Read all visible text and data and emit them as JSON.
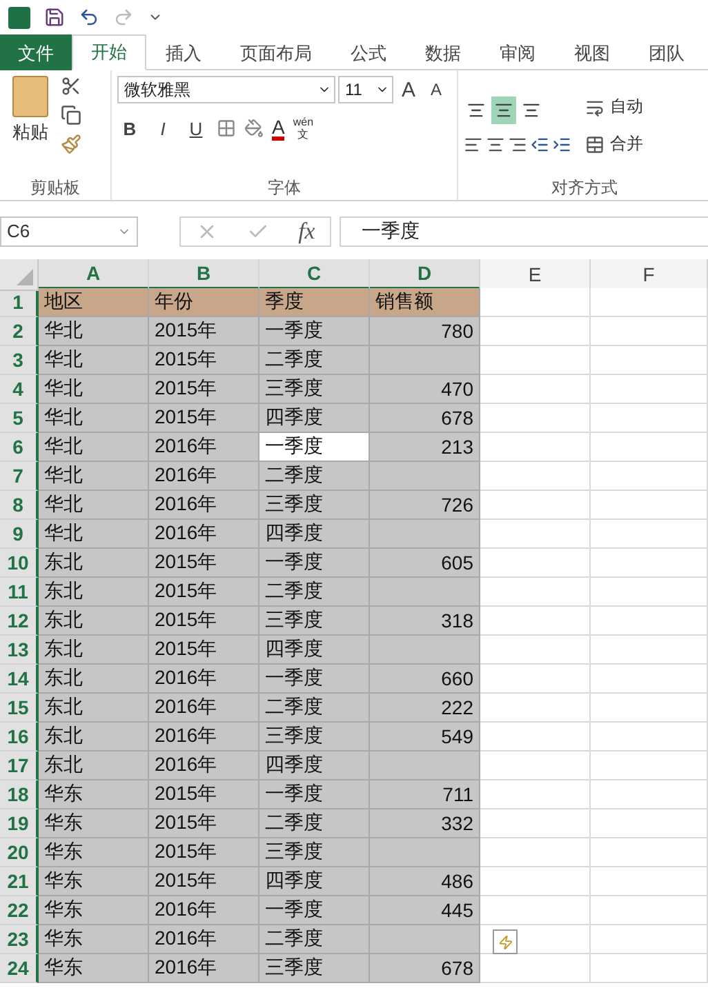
{
  "tabs": [
    {
      "label": "文件",
      "kind": "file",
      "selected": false
    },
    {
      "label": "开始",
      "kind": "tab",
      "selected": true
    },
    {
      "label": "插入",
      "kind": "tab",
      "selected": false
    },
    {
      "label": "页面布局",
      "kind": "tab",
      "selected": false
    },
    {
      "label": "公式",
      "kind": "tab",
      "selected": false
    },
    {
      "label": "数据",
      "kind": "tab",
      "selected": false
    },
    {
      "label": "审阅",
      "kind": "tab",
      "selected": false
    },
    {
      "label": "视图",
      "kind": "tab",
      "selected": false
    },
    {
      "label": "团队",
      "kind": "tab",
      "selected": false
    }
  ],
  "ribbon": {
    "clipboard": {
      "paste_label": "粘贴",
      "title": "剪贴板"
    },
    "font": {
      "font_name": "微软雅黑",
      "font_size": "11",
      "grow": "A",
      "shrink": "A",
      "bold": "B",
      "italic": "I",
      "underline": "U",
      "font_color": "A",
      "phonetic_top": "wén",
      "phonetic_bottom": "文",
      "title": "字体"
    },
    "alignment": {
      "middle_align_selected": true,
      "wrap_text": "自动",
      "merge": "合并",
      "title": "对齐方式"
    }
  },
  "formula_bar": {
    "name_box": "C6",
    "fx": "fx",
    "value": "一季度"
  },
  "sheet": {
    "columns": [
      {
        "label": "A",
        "selected": true
      },
      {
        "label": "B",
        "selected": true
      },
      {
        "label": "C",
        "selected": true
      },
      {
        "label": "D",
        "selected": true
      },
      {
        "label": "E",
        "selected": false
      },
      {
        "label": "F",
        "selected": false
      }
    ],
    "rows": [
      {
        "number": "1",
        "kind": "header",
        "cells": [
          "地区",
          "年份",
          "季度",
          "销售额"
        ],
        "active": [
          false,
          false,
          false,
          false
        ]
      },
      {
        "number": "2",
        "kind": "data",
        "cells": [
          "华北",
          "2015年",
          "一季度",
          "780"
        ],
        "active": [
          false,
          false,
          false,
          false
        ]
      },
      {
        "number": "3",
        "kind": "data",
        "cells": [
          "华北",
          "2015年",
          "二季度",
          null
        ],
        "active": [
          false,
          false,
          false,
          false
        ]
      },
      {
        "number": "4",
        "kind": "data",
        "cells": [
          "华北",
          "2015年",
          "三季度",
          "470"
        ],
        "active": [
          false,
          false,
          false,
          false
        ]
      },
      {
        "number": "5",
        "kind": "data",
        "cells": [
          "华北",
          "2015年",
          "四季度",
          "678"
        ],
        "active": [
          false,
          false,
          false,
          false
        ]
      },
      {
        "number": "6",
        "kind": "data",
        "cells": [
          "华北",
          "2016年",
          "一季度",
          "213"
        ],
        "active": [
          false,
          false,
          true,
          false
        ]
      },
      {
        "number": "7",
        "kind": "data",
        "cells": [
          "华北",
          "2016年",
          "二季度",
          null
        ],
        "active": [
          false,
          false,
          false,
          false
        ]
      },
      {
        "number": "8",
        "kind": "data",
        "cells": [
          "华北",
          "2016年",
          "三季度",
          "726"
        ],
        "active": [
          false,
          false,
          false,
          false
        ]
      },
      {
        "number": "9",
        "kind": "data",
        "cells": [
          "华北",
          "2016年",
          "四季度",
          null
        ],
        "active": [
          false,
          false,
          false,
          false
        ]
      },
      {
        "number": "10",
        "kind": "data",
        "cells": [
          "东北",
          "2015年",
          "一季度",
          "605"
        ],
        "active": [
          false,
          false,
          false,
          false
        ]
      },
      {
        "number": "11",
        "kind": "data",
        "cells": [
          "东北",
          "2015年",
          "二季度",
          null
        ],
        "active": [
          false,
          false,
          false,
          false
        ]
      },
      {
        "number": "12",
        "kind": "data",
        "cells": [
          "东北",
          "2015年",
          "三季度",
          "318"
        ],
        "active": [
          false,
          false,
          false,
          false
        ]
      },
      {
        "number": "13",
        "kind": "data",
        "cells": [
          "东北",
          "2015年",
          "四季度",
          null
        ],
        "active": [
          false,
          false,
          false,
          false
        ]
      },
      {
        "number": "14",
        "kind": "data",
        "cells": [
          "东北",
          "2016年",
          "一季度",
          "660"
        ],
        "active": [
          false,
          false,
          false,
          false
        ]
      },
      {
        "number": "15",
        "kind": "data",
        "cells": [
          "东北",
          "2016年",
          "二季度",
          "222"
        ],
        "active": [
          false,
          false,
          false,
          false
        ]
      },
      {
        "number": "16",
        "kind": "data",
        "cells": [
          "东北",
          "2016年",
          "三季度",
          "549"
        ],
        "active": [
          false,
          false,
          false,
          false
        ]
      },
      {
        "number": "17",
        "kind": "data",
        "cells": [
          "东北",
          "2016年",
          "四季度",
          null
        ],
        "active": [
          false,
          false,
          false,
          false
        ]
      },
      {
        "number": "18",
        "kind": "data",
        "cells": [
          "华东",
          "2015年",
          "一季度",
          "711"
        ],
        "active": [
          false,
          false,
          false,
          false
        ]
      },
      {
        "number": "19",
        "kind": "data",
        "cells": [
          "华东",
          "2015年",
          "二季度",
          "332"
        ],
        "active": [
          false,
          false,
          false,
          false
        ]
      },
      {
        "number": "20",
        "kind": "data",
        "cells": [
          "华东",
          "2015年",
          "三季度",
          null
        ],
        "active": [
          false,
          false,
          false,
          false
        ]
      },
      {
        "number": "21",
        "kind": "data",
        "cells": [
          "华东",
          "2015年",
          "四季度",
          "486"
        ],
        "active": [
          false,
          false,
          false,
          false
        ]
      },
      {
        "number": "22",
        "kind": "data",
        "cells": [
          "华东",
          "2016年",
          "一季度",
          "445"
        ],
        "active": [
          false,
          false,
          false,
          false
        ]
      },
      {
        "number": "23",
        "kind": "data",
        "cells": [
          "华东",
          "2016年",
          "二季度",
          null
        ],
        "active": [
          false,
          false,
          false,
          false
        ]
      },
      {
        "number": "24",
        "kind": "data",
        "cells": [
          "华东",
          "2016年",
          "三季度",
          "678"
        ],
        "active": [
          false,
          false,
          false,
          false
        ]
      }
    ]
  }
}
